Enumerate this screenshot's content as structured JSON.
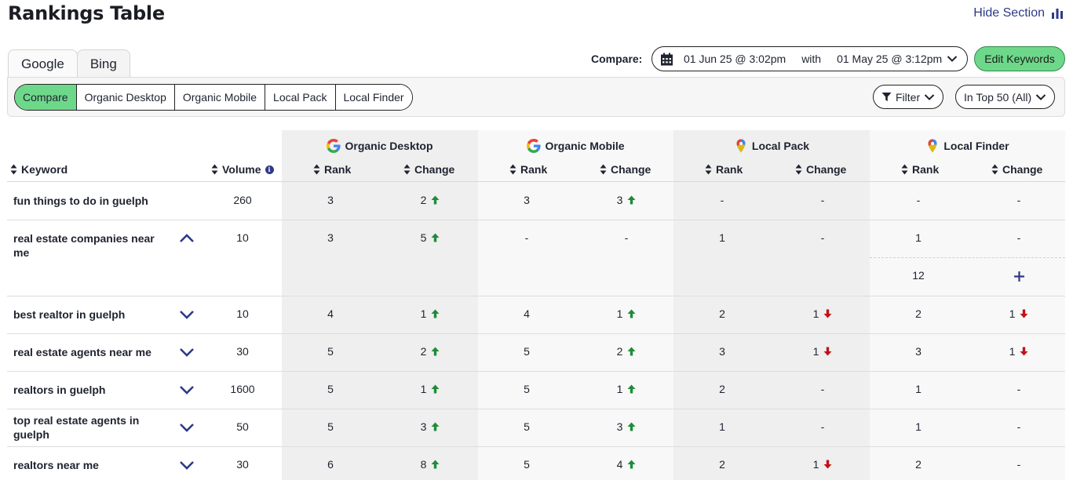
{
  "header": {
    "title": "Rankings Table",
    "hide_section": "Hide Section"
  },
  "engine_tabs": [
    "Google",
    "Bing"
  ],
  "report_tabs": [
    "Compare",
    "Organic Desktop",
    "Organic Mobile",
    "Local Pack",
    "Local Finder"
  ],
  "compare": {
    "label": "Compare:",
    "from": "01 Jun 25 @ 3:02pm",
    "with": "with",
    "to": "01 May 25 @ 3:12pm"
  },
  "edit_keywords": "Edit Keywords",
  "filters": {
    "filter": "Filter",
    "range": "In Top 50 (All)"
  },
  "colors": {
    "accent_green": "#6ed88a",
    "nav_blue": "#2e3a88",
    "up_green": "#1e8c3a",
    "down_red": "#c0131a"
  },
  "table": {
    "keyword_header": "Keyword",
    "volume_header": "Volume",
    "rank_header": "Rank",
    "change_header": "Change",
    "groups": [
      "Organic Desktop",
      "Organic Mobile",
      "Local Pack",
      "Local Finder"
    ],
    "rows": [
      {
        "keyword": "fun things to do in guelph",
        "volume": "260",
        "od_rank": "3",
        "od_change": "2",
        "od_dir": "up",
        "om_rank": "3",
        "om_change": "3",
        "om_dir": "up",
        "lp_rank": "-",
        "lp_change": "-",
        "lp_dir": "",
        "lf_rank": "-",
        "lf_change": "-",
        "lf_dir": "",
        "toggle": ""
      },
      {
        "keyword": "real estate companies near me",
        "volume": "10",
        "od_rank": "3",
        "od_change": "5",
        "od_dir": "up",
        "om_rank": "-",
        "om_change": "-",
        "om_dir": "",
        "lp_rank": "1",
        "lp_change": "-",
        "lp_dir": "",
        "lf_rank": "1",
        "lf_change": "-",
        "lf_dir": "",
        "toggle": "up",
        "extra_lf_rank": "12"
      },
      {
        "keyword": "best realtor in guelph",
        "volume": "10",
        "od_rank": "4",
        "od_change": "1",
        "od_dir": "up",
        "om_rank": "4",
        "om_change": "1",
        "om_dir": "up",
        "lp_rank": "2",
        "lp_change": "1",
        "lp_dir": "down",
        "lf_rank": "2",
        "lf_change": "1",
        "lf_dir": "down",
        "toggle": "down"
      },
      {
        "keyword": "real estate agents near me",
        "volume": "30",
        "od_rank": "5",
        "od_change": "2",
        "od_dir": "up",
        "om_rank": "5",
        "om_change": "2",
        "om_dir": "up",
        "lp_rank": "3",
        "lp_change": "1",
        "lp_dir": "down",
        "lf_rank": "3",
        "lf_change": "1",
        "lf_dir": "down",
        "toggle": "down"
      },
      {
        "keyword": "realtors in guelph",
        "volume": "1600",
        "od_rank": "5",
        "od_change": "1",
        "od_dir": "up",
        "om_rank": "5",
        "om_change": "1",
        "om_dir": "up",
        "lp_rank": "2",
        "lp_change": "-",
        "lp_dir": "",
        "lf_rank": "1",
        "lf_change": "-",
        "lf_dir": "",
        "toggle": "down"
      },
      {
        "keyword": "top real estate agents in guelph",
        "volume": "50",
        "od_rank": "5",
        "od_change": "3",
        "od_dir": "up",
        "om_rank": "5",
        "om_change": "3",
        "om_dir": "up",
        "lp_rank": "1",
        "lp_change": "-",
        "lp_dir": "",
        "lf_rank": "1",
        "lf_change": "-",
        "lf_dir": "",
        "toggle": "down"
      },
      {
        "keyword": "realtors near me",
        "volume": "30",
        "od_rank": "6",
        "od_change": "8",
        "od_dir": "up",
        "om_rank": "5",
        "om_change": "4",
        "om_dir": "up",
        "lp_rank": "2",
        "lp_change": "1",
        "lp_dir": "down",
        "lf_rank": "2",
        "lf_change": "-",
        "lf_dir": "",
        "toggle": "down"
      }
    ]
  }
}
